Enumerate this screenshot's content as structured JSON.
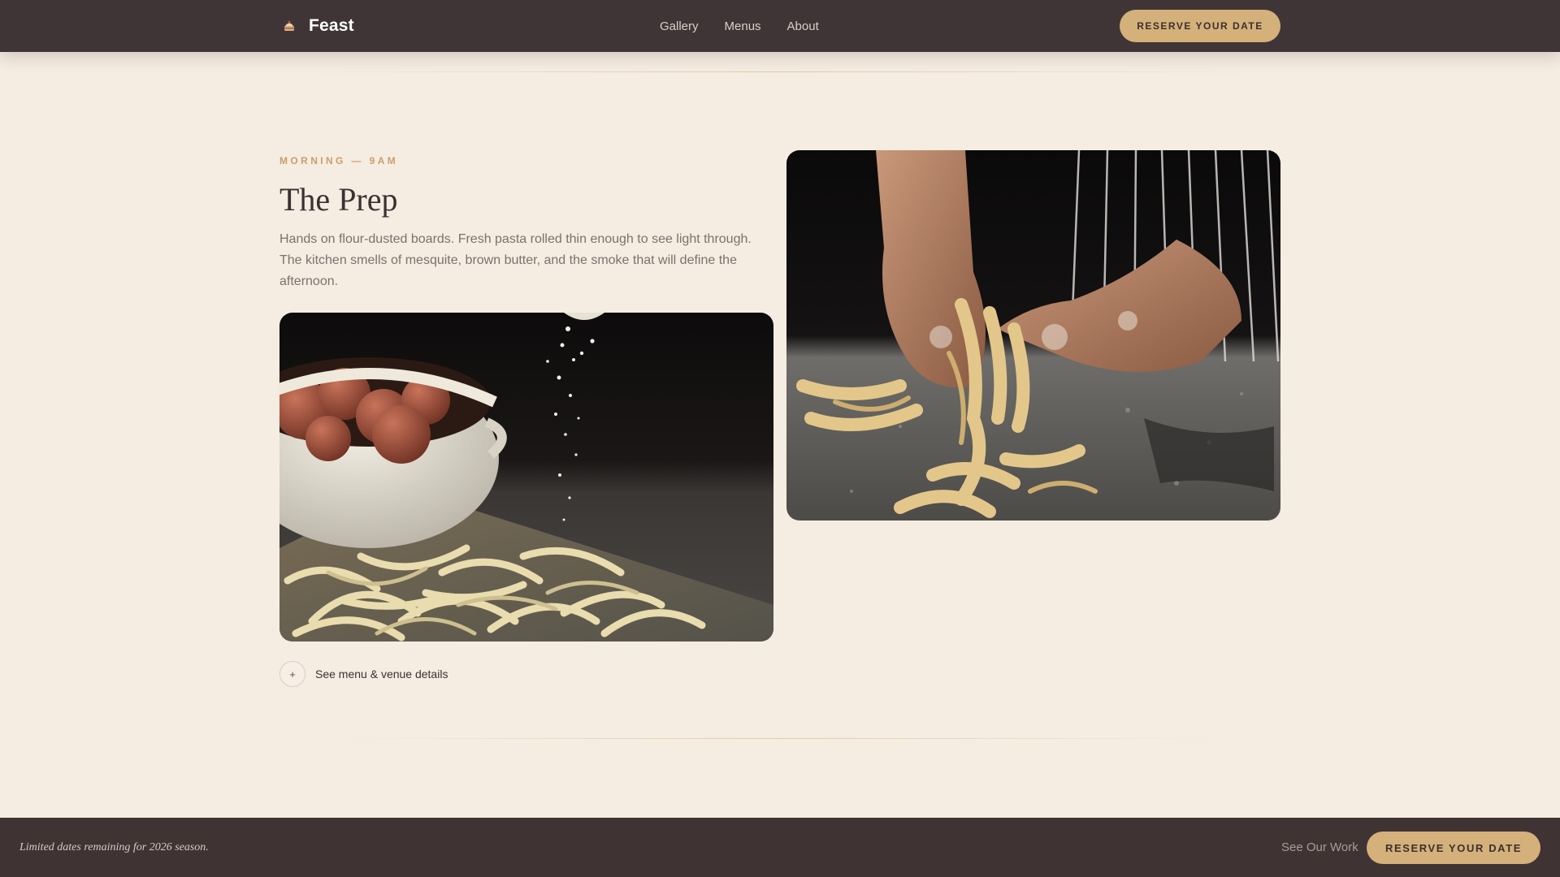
{
  "header": {
    "brand_name": "Feast",
    "brand_icon": "cake-icon",
    "nav": [
      "Gallery",
      "Menus",
      "About"
    ],
    "cta_label": "RESERVE YOUR DATE"
  },
  "section": {
    "eyebrow": "MORNING — 9AM",
    "title": "The Prep",
    "description": "Hands on flour-dusted boards. Fresh pasta rolled thin enough to see light through. The kitchen smells of mesquite, brown butter, and the smoke that will define the afternoon.",
    "details_toggle_icon": "+",
    "details_toggle_label": "See menu & venue details"
  },
  "bottom_bar": {
    "note": "Limited dates remaining for 2026 season.",
    "link": "See Our Work",
    "cta_label": "RESERVE YOUR DATE"
  },
  "colors": {
    "page_background": "#f5ece2",
    "header_background": "#403536",
    "accent_gold": "#d4b07a",
    "eyebrow_gold": "#c9a06a",
    "body_text": "#7d716c"
  }
}
